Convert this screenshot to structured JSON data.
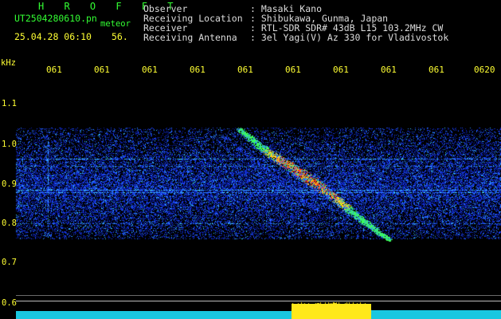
{
  "header": {
    "title": "H R O F F T",
    "filename": "UT2504280610.pn",
    "filename_suffix": "meteor",
    "date_time": "25.04.28 06:10",
    "date_extra": "56."
  },
  "info": [
    {
      "label": "Observer",
      "value": ": Masaki Kano"
    },
    {
      "label": "Receiving Location",
      "value": ": Shibukawa, Gunma, Japan"
    },
    {
      "label": "Receiver",
      "value": ": RTL-SDR SDR# 43dB L15 103.2MHz CW"
    },
    {
      "label": "Receiving Antenna",
      "value": ": 3el Yagi(V) Az 330 for Vladivostok"
    }
  ],
  "axis": {
    "y_unit": "kHz",
    "y_ticks": [
      "1.1",
      "1.0",
      "0.9",
      "0.8",
      "0.7",
      "0.6"
    ],
    "x_ticks": [
      "061",
      "061",
      "061",
      "061",
      "061",
      "061",
      "061",
      "061",
      "061",
      "0620"
    ]
  },
  "colors": {
    "label_green": "#33ff33",
    "label_yellow": "#ffff33",
    "label_white": "#dcdcdc",
    "noise_blue": "#1e46ff",
    "signal_red": "#ff2a1a"
  }
}
